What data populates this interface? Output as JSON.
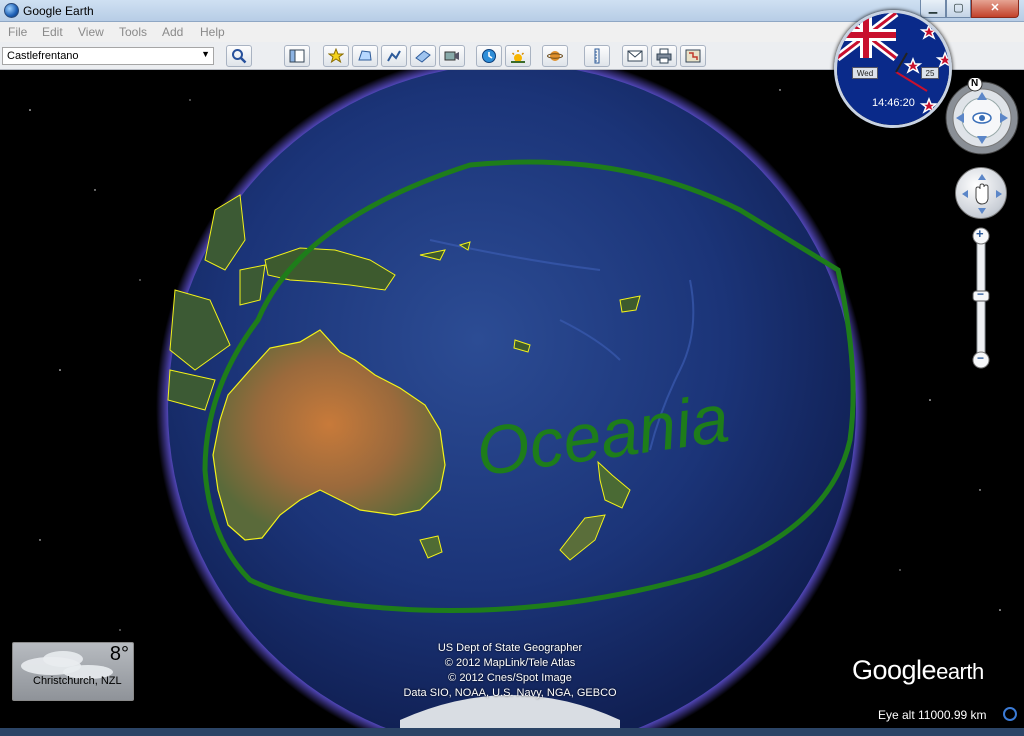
{
  "window": {
    "title": "Google Earth",
    "min_glyph": "▁",
    "max_glyph": "▢",
    "close_glyph": "✕"
  },
  "menu": {
    "items": [
      "File",
      "Edit",
      "View",
      "Tools",
      "Add",
      "Help"
    ]
  },
  "search": {
    "value": "Castlefrentano",
    "dropdown_glyph": "▼"
  },
  "toolbar": {
    "buttons": [
      "search-icon",
      "sidebar-icon",
      "placemark-icon",
      "polygon-icon",
      "path-icon",
      "image-overlay-icon",
      "record-tour-icon",
      "historical-imagery-icon",
      "sunlight-icon",
      "planets-icon",
      "ruler-icon",
      "email-icon",
      "print-icon",
      "view-in-maps-icon"
    ]
  },
  "map": {
    "annotation": "Oceania",
    "credits": [
      "US Dept of State Geographer",
      "© 2012 MapLink/Tele Atlas",
      "© 2012 Cnes/Spot Image",
      "Data SIO, NOAA, U.S. Navy, NGA, GEBCO"
    ],
    "eye_alt": "Eye alt 11000.99 km",
    "annotation_color": "#1e7d1a",
    "border_color": "#f2f21a",
    "atmosphere_color": "#6a5cf0"
  },
  "weather": {
    "temp": "8°",
    "city": "Christchurch, NZL"
  },
  "clock": {
    "day": "Wed",
    "date": "25",
    "time": "14:46:20"
  },
  "nav": {
    "north_label": "N",
    "zoom_in": "+",
    "zoom_out": "−"
  },
  "logo": {
    "brand": "Google",
    "product": "earth"
  }
}
